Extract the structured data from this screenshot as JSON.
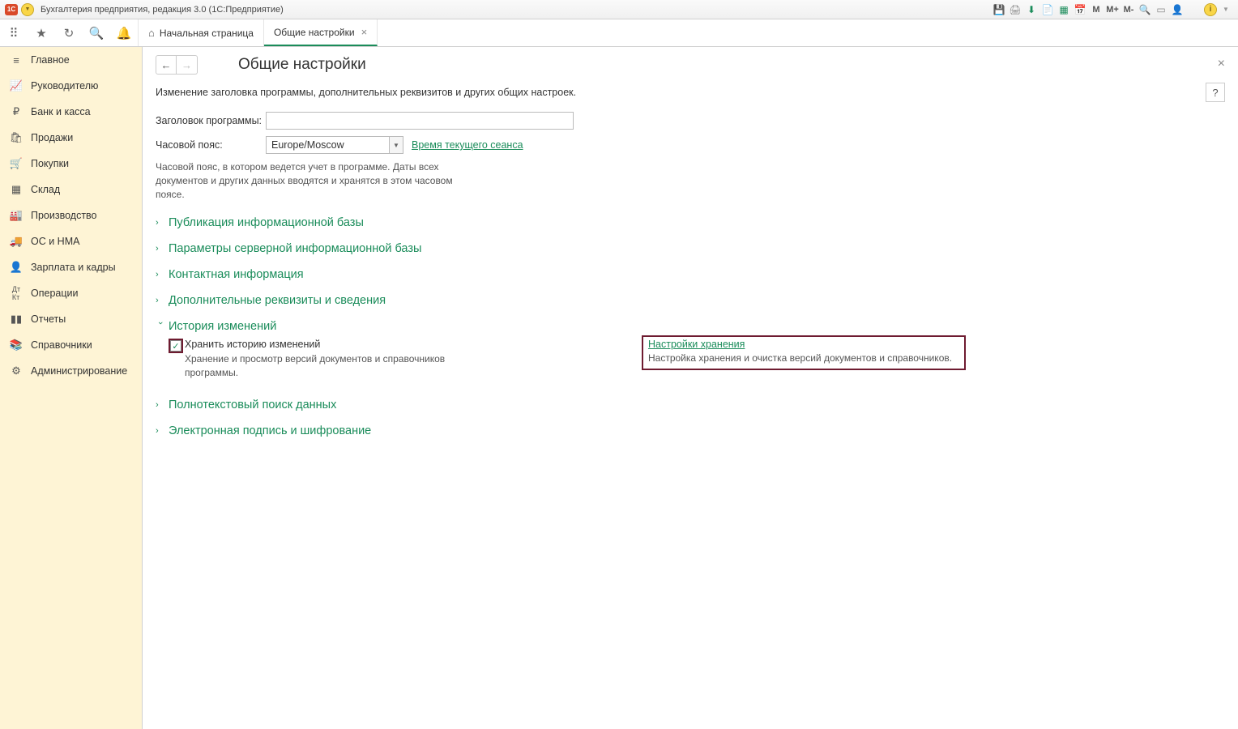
{
  "titlebar": {
    "appTitle": "Бухгалтерия предприятия, редакция 3.0  (1С:Предприятие)"
  },
  "toolbarIcons": {
    "m": "M",
    "mplus": "M+",
    "mminus": "M-"
  },
  "tabs": {
    "home": "Начальная страница",
    "active": "Общие настройки"
  },
  "sidebar": {
    "items": [
      {
        "label": "Главное"
      },
      {
        "label": "Руководителю"
      },
      {
        "label": "Банк и касса"
      },
      {
        "label": "Продажи"
      },
      {
        "label": "Покупки"
      },
      {
        "label": "Склад"
      },
      {
        "label": "Производство"
      },
      {
        "label": "ОС и НМА"
      },
      {
        "label": "Зарплата и кадры"
      },
      {
        "label": "Операции"
      },
      {
        "label": "Отчеты"
      },
      {
        "label": "Справочники"
      },
      {
        "label": "Администрирование"
      }
    ]
  },
  "page": {
    "title": "Общие настройки",
    "description": "Изменение заголовка программы, дополнительных реквизитов и других общих настроек.",
    "help": "?",
    "fields": {
      "titleLabel": "Заголовок программы:",
      "tzLabel": "Часовой пояс:",
      "tzValue": "Europe/Moscow",
      "tzLink": "Время текущего сеанса",
      "tzHint": "Часовой пояс, в котором ведется учет в программе. Даты всех документов и других данных вводятся и хранятся в этом часовом поясе."
    },
    "sections": {
      "s1": "Публикация информационной базы",
      "s2": "Параметры серверной информационной базы",
      "s3": "Контактная информация",
      "s4": "Дополнительные реквизиты и сведения",
      "s5": "История изменений",
      "s6": "Полнотекстовый поиск данных",
      "s7": "Электронная подпись и шифрование"
    },
    "history": {
      "cbLabel": "Хранить историю изменений",
      "cbHint": "Хранение и просмотр версий документов и справочников программы.",
      "link": "Настройки хранения",
      "linkDesc": "Настройка хранения и очистка версий документов и справочников."
    }
  }
}
